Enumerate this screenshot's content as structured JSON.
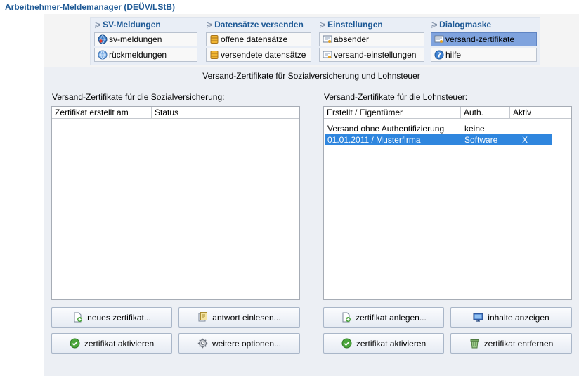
{
  "app_title": "Arbeitnehmer-Meldemanager (DEÜV/LStB)",
  "toolbar": {
    "columns": [
      {
        "title": "SV-Meldungen",
        "items": [
          {
            "label": "sv-meldungen",
            "icon": "sv-globe-icon"
          },
          {
            "label": "rückmeldungen",
            "icon": "return-globe-icon"
          }
        ]
      },
      {
        "title": "Datensätze versenden",
        "items": [
          {
            "label": "offene datensätze",
            "icon": "records-stack-icon"
          },
          {
            "label": "versendete datensätze",
            "icon": "records-stack-icon"
          }
        ]
      },
      {
        "title": "Einstellungen",
        "items": [
          {
            "label": "absender",
            "icon": "certificate-icon"
          },
          {
            "label": "versand-einstellungen",
            "icon": "certificate-icon"
          }
        ]
      },
      {
        "title": "Dialogmaske",
        "items": [
          {
            "label": "versand-zertifikate",
            "icon": "certificate-icon",
            "active": true
          },
          {
            "label": "hilfe",
            "icon": "help-icon"
          }
        ]
      }
    ]
  },
  "main": {
    "heading": "Versand-Zertifikate für Sozialversicherung und Lohnsteuer",
    "left": {
      "label": "Versand-Zertifikate für die Sozialversicherung:",
      "columns": [
        "Zertifikat erstellt am",
        "Status"
      ],
      "rows": [],
      "buttons": {
        "new": "neues zertifikat...",
        "read_answer": "antwort einlesen...",
        "activate": "zertifikat aktivieren",
        "more_options": "weitere optionen..."
      }
    },
    "right": {
      "label": "Versand-Zertifikate für die Lohnsteuer:",
      "columns": [
        "Erstellt / Eigentümer",
        "Auth.",
        "Aktiv"
      ],
      "rows": [
        {
          "owner": "Versand ohne Authentifizierung",
          "auth": "keine",
          "active": ""
        },
        {
          "owner": "01.01.2011 / Musterfirma",
          "auth": "Software",
          "active": "X",
          "selected": true
        }
      ],
      "buttons": {
        "create": "zertifikat anlegen...",
        "show_content": "inhalte anzeigen",
        "activate": "zertifikat aktivieren",
        "remove": "zertifikat entfernen"
      }
    }
  },
  "colors": {
    "accent": "#1f5a96",
    "selection": "#2f86de",
    "active_tab": "#7fa3de",
    "panel_bg": "#eceff4"
  }
}
